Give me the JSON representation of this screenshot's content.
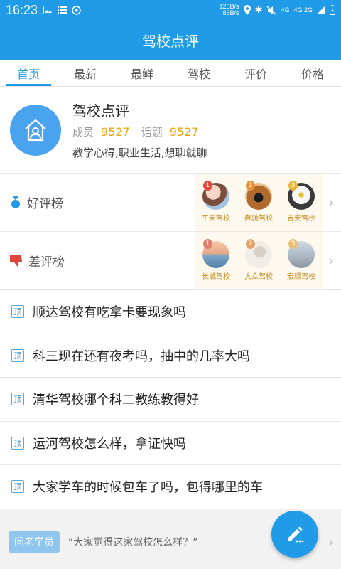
{
  "status_bar": {
    "time": "16:23",
    "net_up": "126B/s",
    "net_down": "86B/s",
    "sim1": "4G",
    "sim2": "4G 2G",
    "left_icons": [
      "image-icon",
      "list-icon",
      "sync-icon"
    ]
  },
  "header": {
    "title": "驾校点评"
  },
  "tabs": [
    {
      "label": "首页",
      "active": true
    },
    {
      "label": "最新"
    },
    {
      "label": "最鲜"
    },
    {
      "label": "驾校"
    },
    {
      "label": "评价"
    },
    {
      "label": "价格"
    }
  ],
  "forum": {
    "title": "驾校点评",
    "members_label": "成员",
    "members_count": "9527",
    "topics_label": "话题",
    "topics_count": "9527",
    "description": "教学心得,职业生活,想聊就聊"
  },
  "good_rank": {
    "label": "好评榜",
    "items": [
      {
        "rank": "1",
        "name": "平安驾校"
      },
      {
        "rank": "2",
        "name": "奔驰驾校"
      },
      {
        "rank": "3",
        "name": "吉安驾校"
      }
    ]
  },
  "bad_rank": {
    "label": "差评榜",
    "items": [
      {
        "rank": "1",
        "name": "长城驾校"
      },
      {
        "rank": "2",
        "name": "大众驾校"
      },
      {
        "rank": "3",
        "name": "宏顺驾校"
      }
    ]
  },
  "pin_label": "顶",
  "topics": [
    {
      "title": "顺达驾校有吃拿卡要现象吗"
    },
    {
      "title": "科三现在还有夜考吗，抽中的几率大吗"
    },
    {
      "title": "清华驾校哪个科二教练教得好"
    },
    {
      "title": "运河驾校怎么样，拿证快吗"
    },
    {
      "title": "大家学车的时候包车了吗，包得哪里的车"
    }
  ],
  "ask": {
    "tag": "问老学员",
    "text": "“大家觉得这家驾校怎么样？”"
  },
  "colors": {
    "primary": "#1f9be8",
    "accent_number": "#f0a30a",
    "rank_gold": "#e8b53a",
    "rank_red": "#e0473a"
  }
}
